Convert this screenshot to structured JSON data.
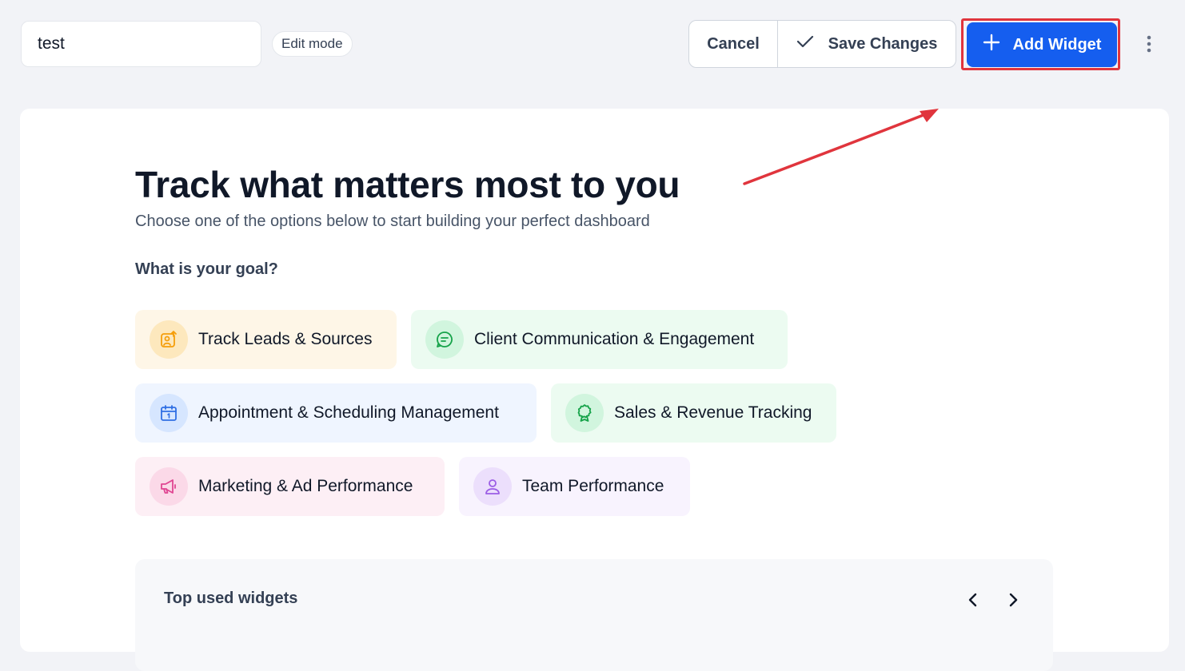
{
  "header": {
    "dashboard_name": "test",
    "mode_badge": "Edit mode",
    "cancel_label": "Cancel",
    "save_label": "Save Changes",
    "add_widget_label": "Add Widget"
  },
  "main": {
    "title": "Track what matters most to you",
    "subtitle": "Choose one of the options below to start building your perfect dashboard",
    "goal_question": "What is your goal?",
    "goals": [
      {
        "label": "Track Leads & Sources",
        "icon": "lead-source-icon",
        "bg": "#fef6e7",
        "icon_bg": "#fde8bd",
        "icon_color": "#f59e0b"
      },
      {
        "label": "Client Communication & Engagement",
        "icon": "chat-bubble-icon",
        "bg": "#ecfbf1",
        "icon_bg": "#d1f5de",
        "icon_color": "#16a34a"
      },
      {
        "label": "Appointment & Scheduling Management",
        "icon": "calendar-icon",
        "bg": "#eff5ff",
        "icon_bg": "#d6e6ff",
        "icon_color": "#2f6fe4"
      },
      {
        "label": "Sales & Revenue Tracking",
        "icon": "award-ribbon-icon",
        "bg": "#ecfbf1",
        "icon_bg": "#d1f5de",
        "icon_color": "#16a34a"
      },
      {
        "label": "Marketing & Ad Performance",
        "icon": "megaphone-icon",
        "bg": "#fdeff5",
        "icon_bg": "#fbd9e8",
        "icon_color": "#e04592"
      },
      {
        "label": "Team Performance",
        "icon": "user-icon",
        "bg": "#f8f3fe",
        "icon_bg": "#ecdffc",
        "icon_color": "#9b5de5"
      }
    ],
    "top_widgets_title": "Top used widgets"
  },
  "colors": {
    "accent": "#155eef",
    "highlight": "#e0353d"
  }
}
